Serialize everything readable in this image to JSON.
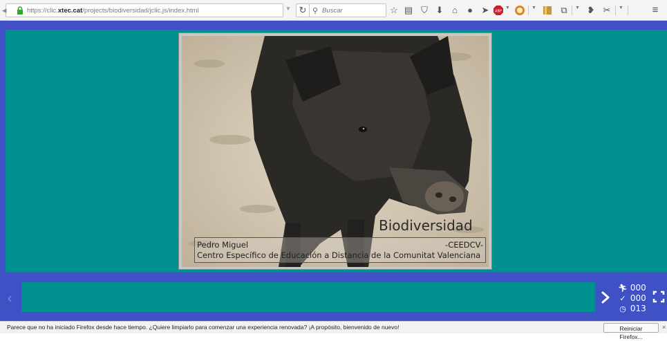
{
  "browser": {
    "url_prefix": "https://clic.",
    "url_domain": "xtec.cat",
    "url_path": "/projects/biodiversidad/jclic.js/index.html",
    "search_placeholder": "Buscar"
  },
  "toolbar_icons": [
    "star-icon",
    "reading-list-icon",
    "pocket-icon",
    "download-icon",
    "home-icon",
    "chat-icon",
    "send-icon",
    "adblock-plus-icon",
    "extension-icon",
    "bookmarks-icon",
    "screenshot-icon",
    "speed-dial-icon",
    "share-icon",
    "menu-icon"
  ],
  "activity": {
    "title": "Biodiversidad",
    "author": "Pedro Miguel",
    "org_code": "-CEEDCV-",
    "center": "Centro Específico de Educación a Distancia de la Comunitat Valenciana"
  },
  "controls": {
    "prev_glyph": "‹",
    "next_glyph": "›"
  },
  "counters": {
    "actions": "000",
    "correct": "000",
    "time": "013"
  },
  "notification": {
    "text": "Parece que no ha iniciado Firefox desde hace tiempo. ¿Quiere limpiarlo para comenzar una experiencia renovada? ¡A propósito, bienvenido de nuevo!",
    "button_label": "Reiniciar Firefox...",
    "close_glyph": "×"
  },
  "colors": {
    "stage_teal": "#00908e",
    "frame_blue": "#3f51c5"
  }
}
